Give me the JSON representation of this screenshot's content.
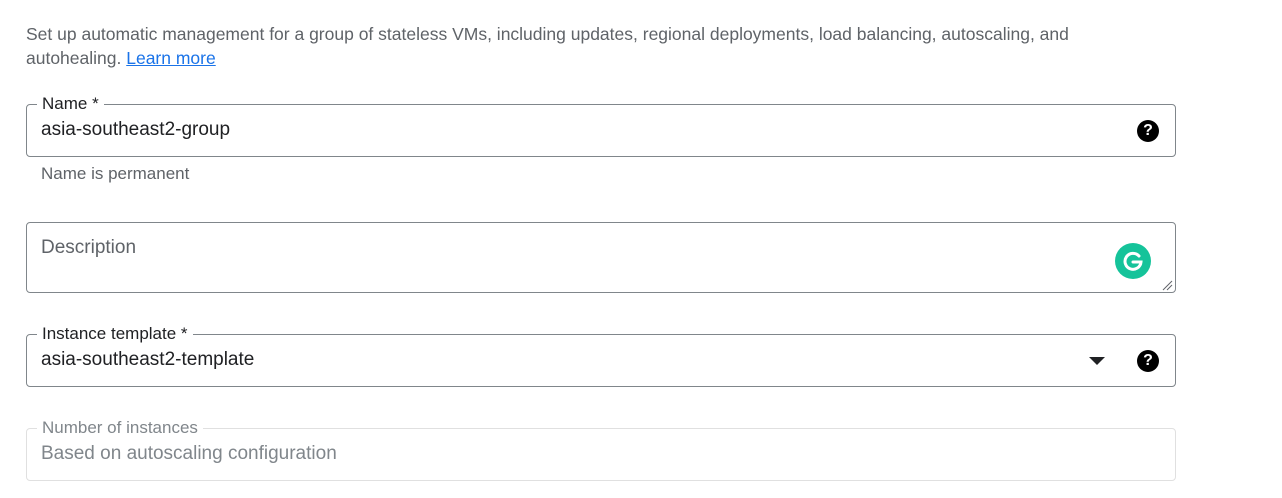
{
  "intro": {
    "text": "Set up automatic management for a group of stateless VMs, including updates, regional deployments, load balancing, autoscaling, and autohealing. ",
    "learn_more": "Learn more"
  },
  "name_field": {
    "label": "Name *",
    "value": "asia-southeast2-group",
    "hint": "Name is permanent",
    "help_icon": "?"
  },
  "description_field": {
    "placeholder": "Description",
    "grammarly_icon": "grammarly-icon"
  },
  "template_field": {
    "label": "Instance template *",
    "value": "asia-southeast2-template",
    "help_icon": "?"
  },
  "instances_field": {
    "label": "Number of instances",
    "value": "Based on autoscaling configuration"
  },
  "colors": {
    "link": "#1a73e8",
    "border": "#80868b",
    "grammarly": "#15c39a"
  }
}
